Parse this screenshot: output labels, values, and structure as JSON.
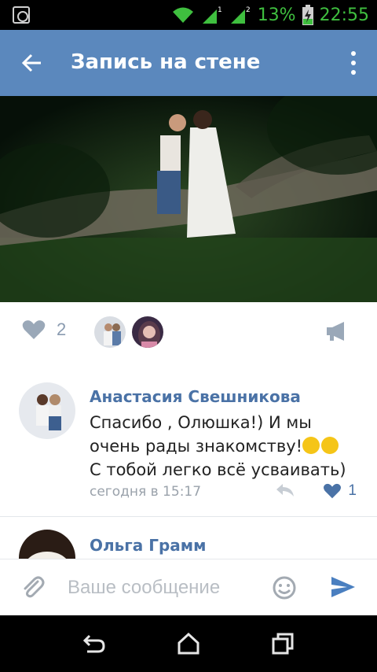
{
  "status_bar": {
    "battery_percent": "13%",
    "time": "22:55",
    "icons": [
      "screenshot-icon",
      "wifi-icon",
      "signal-sim1-icon",
      "signal-sim2-icon",
      "battery-charging-icon"
    ],
    "sim1_label": "1",
    "sim2_label": "2",
    "accent": "#3fbf3f"
  },
  "app_bar": {
    "title": "Запись на стене",
    "background": "#5b88bd",
    "back_icon": "arrow-left-icon",
    "menu_icon": "more-vertical-icon"
  },
  "post": {
    "photo_description_icon": "wedding-photo",
    "likes": "2",
    "liker_count": 2,
    "share_icon": "megaphone-icon"
  },
  "comments": [
    {
      "author": "Анастасия Свешникова",
      "text": "Спасибо , Олюшка!) И мы очень рады знакомству!",
      "text_tail": "С тобой легко всё усваивать)",
      "emojis": [
        "smiling-face-emoji",
        "kissing-face-emoji"
      ],
      "time": "сегодня в 15:17",
      "likes": "1"
    },
    {
      "author": "Ольга Грамм"
    }
  ],
  "composer": {
    "placeholder": "Ваше сообщение",
    "attach_icon": "paperclip-icon",
    "emoji_icon": "smiley-icon",
    "send_icon": "send-icon",
    "send_color": "#4a7fc0"
  },
  "nav_bar": {
    "icons": [
      "back-nav-icon",
      "home-nav-icon",
      "recents-nav-icon"
    ]
  }
}
